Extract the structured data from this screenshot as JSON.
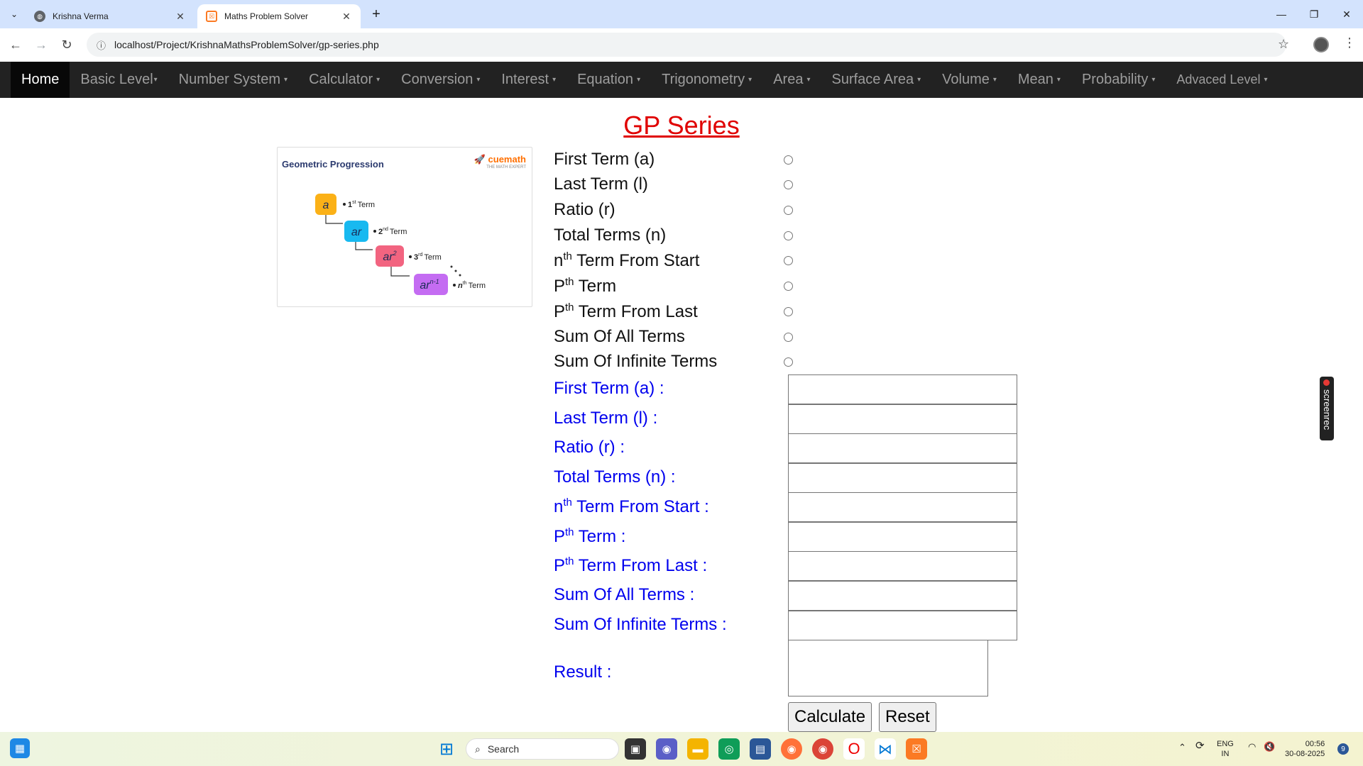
{
  "browser": {
    "tabs": [
      {
        "title": "Krishna Verma",
        "active": false
      },
      {
        "title": "Maths Problem Solver",
        "active": true
      }
    ],
    "url": "localhost/Project/KrishnaMathsProblemSolver/gp-series.php"
  },
  "nav": {
    "items": [
      {
        "label": "Home",
        "active": true
      },
      {
        "label": "Basic Level"
      },
      {
        "label": "Number System"
      },
      {
        "label": "Calculator"
      },
      {
        "label": "Conversion"
      },
      {
        "label": "Interest"
      },
      {
        "label": "Equation"
      },
      {
        "label": "Trigonometry"
      },
      {
        "label": "Area"
      },
      {
        "label": "Surface Area"
      },
      {
        "label": "Volume"
      },
      {
        "label": "Mean"
      },
      {
        "label": "Probability"
      },
      {
        "label": "Advaced Level"
      }
    ]
  },
  "page": {
    "title": "GP Series",
    "image": {
      "title": "Geometric Progression",
      "logo": "cuemath",
      "logo_sub": "THE MATH EXPERT",
      "terms": [
        {
          "box": "a",
          "num": "1",
          "suffix": "st",
          "word": "Term",
          "color": "#fbb117"
        },
        {
          "box": "ar",
          "num": "2",
          "suffix": "nd",
          "word": "Term",
          "color": "#18b9f0"
        },
        {
          "box": "ar",
          "exp": "2",
          "num": "3",
          "suffix": "rd",
          "word": "Term",
          "color": "#f26480"
        },
        {
          "box": "ar",
          "exp": "n-1",
          "num": "n",
          "suffix": "th",
          "word": "Term",
          "color": "#c46cf2"
        }
      ]
    },
    "options": {
      "first_term": "First Term (a)",
      "last_term": "Last Term (l)",
      "ratio": "Ratio (r)",
      "total_terms": "Total Terms (n)",
      "nth_n": "n",
      "nth_sup": "th",
      "nth_rest": " Term From Start",
      "pth_p": "P",
      "pth_sup": "th",
      "pth_rest": " Term",
      "pthl_p": "P",
      "pthl_sup": "th",
      "pthl_rest": " Term From Last",
      "sum_all": "Sum Of All Terms",
      "sum_inf": "Sum Of Infinite Terms"
    },
    "fields": {
      "first_term": "First Term (a) :",
      "last_term": "Last Term (l) :",
      "ratio": "Ratio (r) :",
      "total_terms": "Total Terms (n) :",
      "nth_n": "n",
      "nth_sup": "th",
      "nth_rest": " Term From Start :",
      "pth_p": "P",
      "pth_sup": "th",
      "pth_rest": " Term :",
      "pthl_p": "P",
      "pthl_sup": "th",
      "pthl_rest": " Term From Last :",
      "sum_all": "Sum Of All Terms :",
      "sum_inf": "Sum Of Infinite Terms :",
      "result": "Result :"
    },
    "buttons": {
      "calculate": "Calculate",
      "reset": "Reset"
    }
  },
  "overlay": {
    "screenrec": "screenrec"
  },
  "taskbar": {
    "search_placeholder": "Search",
    "lang_top": "ENG",
    "lang_bottom": "IN",
    "time": "00:56",
    "date": "30-08-2025",
    "notifications": "9"
  }
}
